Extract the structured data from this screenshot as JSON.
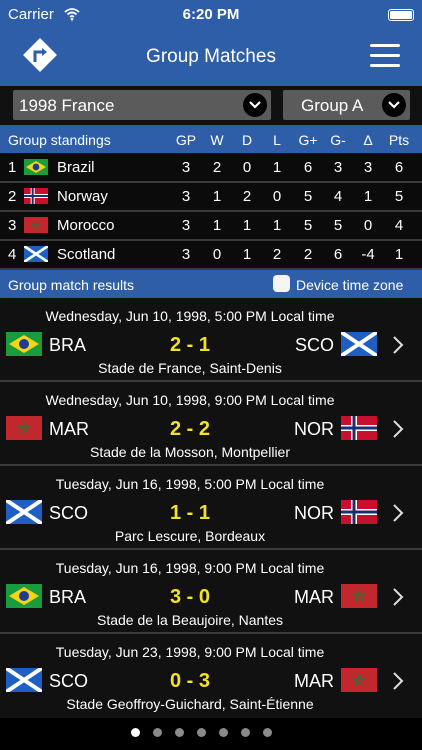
{
  "status": {
    "carrier": "Carrier",
    "time": "6:20 PM"
  },
  "navbar": {
    "title": "Group Matches"
  },
  "selectors": {
    "tournament": "1998 France",
    "group": "Group A"
  },
  "standings": {
    "title": "Group standings",
    "columns": [
      "GP",
      "W",
      "D",
      "L",
      "G+",
      "G-",
      "Δ",
      "Pts"
    ],
    "rows": [
      {
        "rank": "1",
        "team": "Brazil",
        "flag": "brazil-flag",
        "stats": [
          "3",
          "2",
          "0",
          "1",
          "6",
          "3",
          "3",
          "6"
        ]
      },
      {
        "rank": "2",
        "team": "Norway",
        "flag": "norway-flag",
        "stats": [
          "3",
          "1",
          "2",
          "0",
          "5",
          "4",
          "1",
          "5"
        ]
      },
      {
        "rank": "3",
        "team": "Morocco",
        "flag": "morocco-flag",
        "stats": [
          "3",
          "1",
          "1",
          "1",
          "5",
          "5",
          "0",
          "4"
        ]
      },
      {
        "rank": "4",
        "team": "Scotland",
        "flag": "scotland-flag",
        "stats": [
          "3",
          "0",
          "1",
          "2",
          "2",
          "6",
          "-4",
          "1"
        ]
      }
    ]
  },
  "results": {
    "title": "Group match results",
    "device_time_zone_label": "Device time zone",
    "matches": [
      {
        "date": "Wednesday, Jun 10, 1998, 5:00 PM Local time",
        "home": "BRA",
        "score": "2 - 1",
        "away": "SCO",
        "venue": "Stade de France, Saint-Denis",
        "home_flag": "brazil-flag",
        "away_flag": "scotland-flag"
      },
      {
        "date": "Wednesday, Jun 10, 1998, 9:00 PM Local time",
        "home": "MAR",
        "score": "2 - 2",
        "away": "NOR",
        "venue": "Stade de la Mosson, Montpellier",
        "home_flag": "morocco-flag",
        "away_flag": "norway-flag"
      },
      {
        "date": "Tuesday, Jun 16, 1998, 5:00 PM Local time",
        "home": "SCO",
        "score": "1 - 1",
        "away": "NOR",
        "venue": "Parc Lescure, Bordeaux",
        "home_flag": "scotland-flag",
        "away_flag": "norway-flag"
      },
      {
        "date": "Tuesday, Jun 16, 1998, 9:00 PM Local time",
        "home": "BRA",
        "score": "3 - 0",
        "away": "MAR",
        "venue": "Stade de la Beaujoire, Nantes",
        "home_flag": "brazil-flag",
        "away_flag": "morocco-flag"
      },
      {
        "date": "Tuesday, Jun 23, 1998, 9:00 PM Local time",
        "home": "SCO",
        "score": "0 - 3",
        "away": "MAR",
        "venue": "Stade Geoffroy-Guichard, Saint-Étienne",
        "home_flag": "scotland-flag",
        "away_flag": "morocco-flag"
      }
    ]
  },
  "pagination": {
    "total": 7,
    "active_index": 0
  },
  "colors": {
    "nav_blue": "#2e5ea8",
    "score_yellow": "#f2e228"
  }
}
